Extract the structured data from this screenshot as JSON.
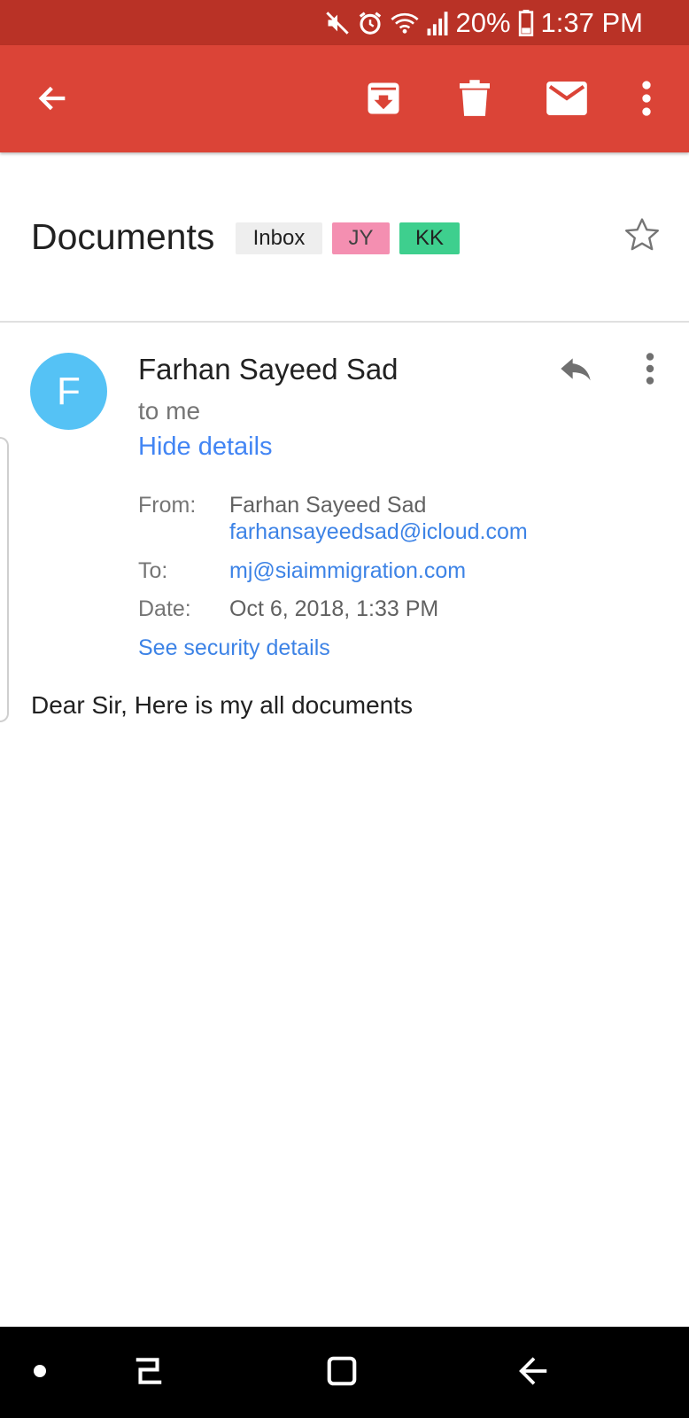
{
  "status_bar": {
    "battery_percent": "20%",
    "time": "1:37 PM",
    "icons": [
      "mute-icon",
      "alarm-icon",
      "wifi-icon",
      "signal-icon",
      "battery-icon"
    ]
  },
  "app_bar": {
    "icons": [
      "back-arrow-icon",
      "archive-icon",
      "delete-icon",
      "mark-unread-icon",
      "more-vert-icon"
    ]
  },
  "email": {
    "subject": "Documents",
    "labels": [
      {
        "text": "Inbox",
        "bg": "#eeeeee",
        "color": "#212121"
      },
      {
        "text": "JY",
        "bg": "#f48fb1",
        "color": "#424242"
      },
      {
        "text": "KK",
        "bg": "#3ecf8e",
        "color": "#212121"
      }
    ],
    "sender_initial": "F",
    "sender_name": "Farhan Sayeed Sad",
    "recipient_summary": "to me",
    "hide_details": "Hide details",
    "details": {
      "from_label": "From:",
      "from_name": "Farhan Sayeed Sad",
      "from_email": "farhansayeedsad@icloud.com",
      "to_label": "To:",
      "to_email": "mj@siaimmigration.com",
      "date_label": "Date:",
      "date_value": "Oct 6, 2018, 1:33 PM",
      "security_link": "See security details"
    },
    "body": "Dear Sir, Here is my all documents"
  },
  "colors": {
    "status_bar": "#b93226",
    "app_bar": "#db4437",
    "avatar": "#55c2f5",
    "link": "#3d83e6"
  }
}
